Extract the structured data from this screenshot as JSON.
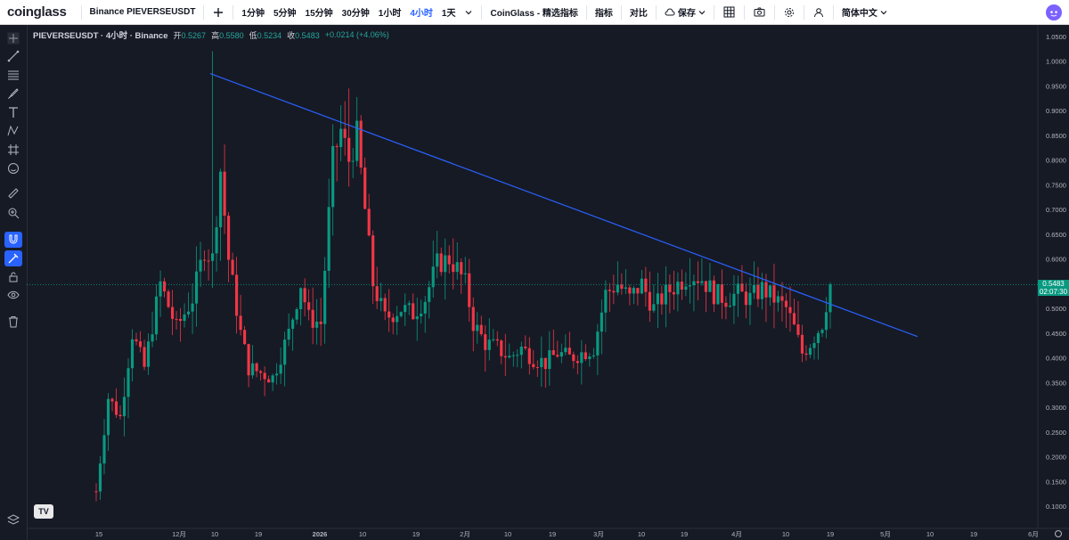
{
  "brand": "coinglass",
  "toolbar": {
    "symbol": "Binance PIEVERSEUSDT",
    "intervals": [
      "1分钟",
      "5分钟",
      "15分钟",
      "30分钟",
      "1小时",
      "4小时",
      "1天"
    ],
    "active_interval": "4小时",
    "indicators_brand": "CoinGlass - 精选指标",
    "indicators": "指标",
    "compare": "对比",
    "save": "保存",
    "language": "简体中文",
    "icons": [
      "candles-icon",
      "grid-icon",
      "camera-icon",
      "gear-icon",
      "user-icon"
    ]
  },
  "legend": {
    "title": "PIEVERSEUSDT · 4小时 · Binance",
    "open_label": "开",
    "open": "0.5267",
    "high_label": "高",
    "high": "0.5580",
    "low_label": "低",
    "low": "0.5234",
    "close_label": "收",
    "close": "0.5483",
    "change": "+0.0214 (+4.06%)"
  },
  "current_price": {
    "value": "0.5483",
    "countdown": "02:07:30"
  },
  "colors": {
    "up": "#089981",
    "down": "#f23645",
    "trendline": "#2962ff",
    "background": "#161a25"
  },
  "chart_data": {
    "type": "candlestick",
    "y_ticks": [
      "1.0500",
      "1.0000",
      "0.9500",
      "0.9000",
      "0.8500",
      "0.8000",
      "0.7500",
      "0.7000",
      "0.6500",
      "0.6000",
      "0.5500",
      "0.5000",
      "0.4500",
      "0.4000",
      "0.3500",
      "0.3000",
      "0.2500",
      "0.2000",
      "0.1500",
      "0.1000"
    ],
    "ylim": [
      0.07,
      1.07
    ],
    "x_ticks": [
      "15",
      "12月",
      "10",
      "19",
      "2026",
      "10",
      "19",
      "2月",
      "10",
      "19",
      "3月",
      "10",
      "19",
      "4月",
      "10",
      "19",
      "5月",
      "10",
      "19",
      "6月"
    ],
    "price_path": [
      [
        0,
        0.13
      ],
      [
        3,
        0.32
      ],
      [
        6,
        0.28
      ],
      [
        9,
        0.45
      ],
      [
        12,
        0.38
      ],
      [
        16,
        0.55
      ],
      [
        20,
        0.46
      ],
      [
        24,
        0.52
      ],
      [
        27,
        0.62
      ],
      [
        29,
        0.6
      ],
      [
        31,
        0.78
      ],
      [
        33,
        0.6
      ],
      [
        36,
        0.45
      ],
      [
        38,
        0.38
      ],
      [
        41,
        0.37
      ],
      [
        44,
        0.36
      ],
      [
        48,
        0.45
      ],
      [
        51,
        0.55
      ],
      [
        53,
        0.48
      ],
      [
        56,
        0.47
      ],
      [
        59,
        0.8
      ],
      [
        61,
        0.86
      ],
      [
        63,
        0.8
      ],
      [
        65,
        0.85
      ],
      [
        67,
        0.7
      ],
      [
        69,
        0.55
      ],
      [
        72,
        0.48
      ],
      [
        76,
        0.5
      ],
      [
        79,
        0.49
      ],
      [
        82,
        0.52
      ],
      [
        85,
        0.59
      ],
      [
        88,
        0.6
      ],
      [
        90,
        0.58
      ],
      [
        92,
        0.55
      ],
      [
        94,
        0.47
      ],
      [
        97,
        0.43
      ],
      [
        100,
        0.42
      ],
      [
        103,
        0.4
      ],
      [
        106,
        0.42
      ],
      [
        109,
        0.4
      ],
      [
        112,
        0.39
      ],
      [
        115,
        0.41
      ],
      [
        118,
        0.4
      ],
      [
        121,
        0.41
      ],
      [
        124,
        0.42
      ],
      [
        127,
        0.53
      ],
      [
        130,
        0.55
      ],
      [
        133,
        0.52
      ],
      [
        136,
        0.55
      ],
      [
        139,
        0.5
      ],
      [
        142,
        0.53
      ],
      [
        145,
        0.55
      ],
      [
        148,
        0.57
      ],
      [
        151,
        0.56
      ],
      [
        154,
        0.53
      ],
      [
        157,
        0.52
      ],
      [
        160,
        0.53
      ],
      [
        163,
        0.52
      ],
      [
        166,
        0.54
      ],
      [
        169,
        0.52
      ],
      [
        172,
        0.5
      ],
      [
        174,
        0.46
      ],
      [
        176,
        0.41
      ],
      [
        178,
        0.43
      ],
      [
        181,
        0.47
      ],
      [
        183,
        0.55
      ]
    ],
    "candle_count": 184,
    "trendline": {
      "from": [
        "11月末",
        0.975
      ],
      "to": [
        "5月初",
        0.443
      ]
    },
    "last_price": 0.5483
  }
}
